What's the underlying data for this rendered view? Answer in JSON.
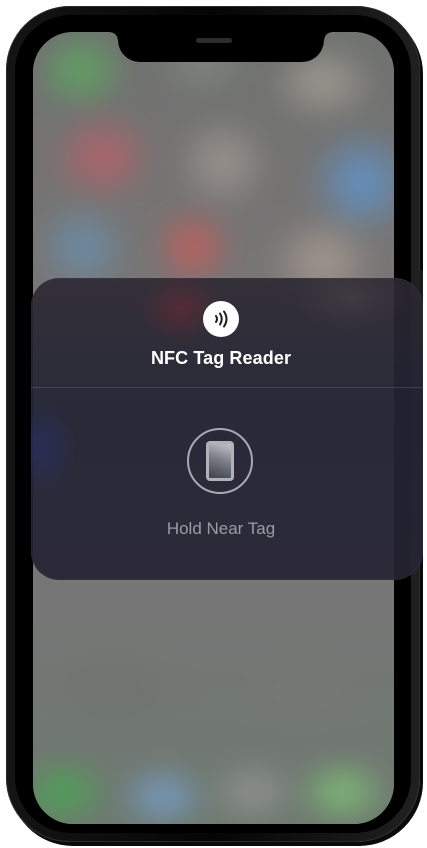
{
  "nfc_sheet": {
    "icon": "nfc-contactless-icon",
    "title": "NFC Tag Reader",
    "prompt_icon": "phone-scan-icon",
    "prompt": "Hold Near Tag"
  },
  "colors": {
    "sheet_background": "#2a2834",
    "title_text": "#ffffff",
    "prompt_text": "#9b9ca3",
    "icon_background": "#ffffff"
  }
}
